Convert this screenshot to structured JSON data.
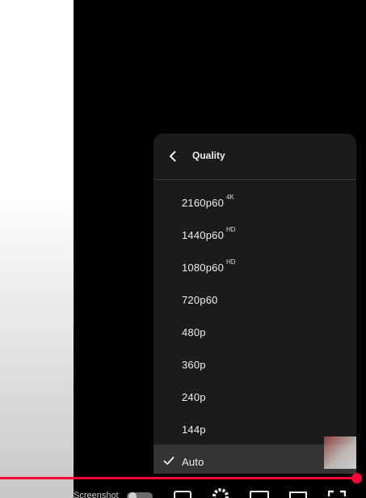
{
  "quality_menu": {
    "title": "Quality",
    "options": [
      {
        "label": "2160p60",
        "badge": "4K",
        "selected": false
      },
      {
        "label": "1440p60",
        "badge": "HD",
        "selected": false
      },
      {
        "label": "1080p60",
        "badge": "HD",
        "selected": false
      },
      {
        "label": "720p60",
        "badge": "",
        "selected": false
      },
      {
        "label": "480p",
        "badge": "",
        "selected": false
      },
      {
        "label": "360p",
        "badge": "",
        "selected": false
      },
      {
        "label": "240p",
        "badge": "",
        "selected": false
      },
      {
        "label": "144p",
        "badge": "",
        "selected": false
      },
      {
        "label": "Auto",
        "badge": "",
        "selected": true
      }
    ]
  },
  "player": {
    "progress": 1.0,
    "progress_color": "#ff0033",
    "screenshot_label": "Screenshot"
  },
  "icons": {
    "back": "chevron-left-icon",
    "selected": "check-icon",
    "screenshot_toggle": "toggle-icon",
    "subtitles": "subtitles-icon",
    "settings": "gear-icon",
    "miniplayer": "miniplayer-icon",
    "theater": "theater-mode-icon",
    "fullscreen": "fullscreen-icon"
  }
}
